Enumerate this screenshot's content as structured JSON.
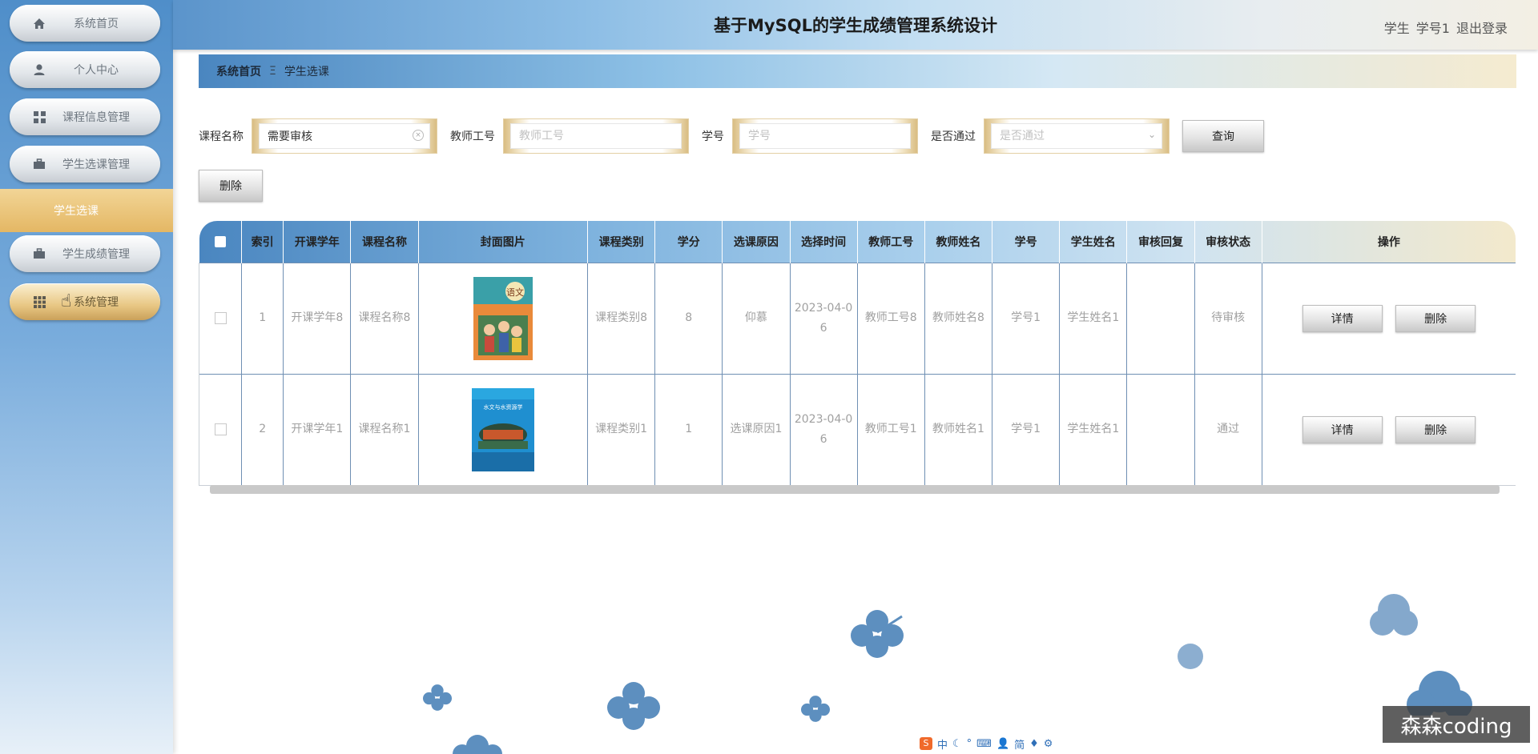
{
  "header": {
    "title": "基于MySQL的学生成绩管理系统设计",
    "role": "学生",
    "username": "学号1",
    "logout": "退出登录"
  },
  "sidebar": {
    "items": [
      {
        "label": "系统首页",
        "icon": "home-icon"
      },
      {
        "label": "个人中心",
        "icon": "user-icon"
      },
      {
        "label": "课程信息管理",
        "icon": "grid-icon"
      },
      {
        "label": "学生选课管理",
        "icon": "briefcase-icon"
      },
      {
        "label": "学生成绩管理",
        "icon": "briefcase-icon"
      },
      {
        "label": "系统管理",
        "icon": "apps-icon"
      }
    ],
    "active_sub": "学生选课"
  },
  "breadcrumb": {
    "home": "系统首页",
    "separator": "Ξ",
    "current": "学生选课"
  },
  "search": {
    "course_name_label": "课程名称",
    "course_name_value": "需要审核",
    "teacher_no_label": "教师工号",
    "teacher_no_placeholder": "教师工号",
    "student_no_label": "学号",
    "student_no_placeholder": "学号",
    "passed_label": "是否通过",
    "passed_placeholder": "是否通过",
    "query_button": "查询"
  },
  "toolbar": {
    "delete_button": "删除"
  },
  "table": {
    "headers": [
      "索引",
      "开课学年",
      "课程名称",
      "封面图片",
      "课程类别",
      "学分",
      "选课原因",
      "选择时间",
      "教师工号",
      "教师姓名",
      "学号",
      "学生姓名",
      "审核回复",
      "审核状态",
      "操作"
    ],
    "rows": [
      {
        "index": "1",
        "year": "开课学年8",
        "course": "课程名称8",
        "category": "课程类别8",
        "credit": "8",
        "reason": "仰慕",
        "time": "2023-04-06",
        "teacher_no": "教师工号8",
        "teacher_name": "教师姓名8",
        "student_no": "学号1",
        "student_name": "学生姓名1",
        "reply": "",
        "status": "待审核",
        "detail_btn": "详情",
        "delete_btn": "删除",
        "cover_title": "语文"
      },
      {
        "index": "2",
        "year": "开课学年1",
        "course": "课程名称1",
        "category": "课程类别1",
        "credit": "1",
        "reason": "选课原因1",
        "time": "2023-04-06",
        "teacher_no": "教师工号1",
        "teacher_name": "教师姓名1",
        "student_no": "学号1",
        "student_name": "学生姓名1",
        "reply": "",
        "status": "通过",
        "detail_btn": "详情",
        "delete_btn": "删除",
        "cover_title": "水文与水资源学"
      }
    ]
  },
  "ime": {
    "logo": "S",
    "mode": "中",
    "charset": "简"
  },
  "watermark": "森森coding",
  "colors": {
    "primary_blue": "#4a86c0",
    "gold": "#e4b764",
    "sidebar_top": "#4f8ec9"
  }
}
